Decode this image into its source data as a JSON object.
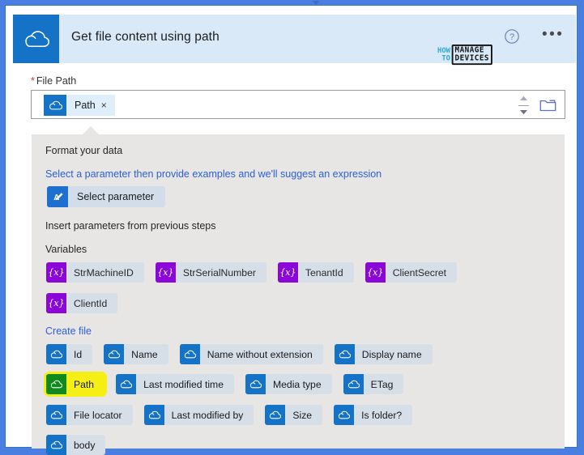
{
  "window": {
    "frame_color": "#4a7ee0",
    "inner_border_color": "#2f7ab5"
  },
  "header": {
    "title": "Get file content using path",
    "connector_icon": "onedrive-cloud-icon",
    "help_icon": "help-question-icon",
    "more_icon": "more-ellipsis-icon",
    "background": "#d9e9f8"
  },
  "watermark": {
    "line1": "HOW",
    "line2": "TO",
    "boxed1": "MANAGE",
    "boxed2": "DEVICES",
    "accent": "#29a9e0"
  },
  "file_path": {
    "label": "File Path",
    "required_marker": "*",
    "chip": {
      "label": "Path",
      "remove": "×",
      "icon": "onedrive-cloud-icon"
    },
    "stepper_icon": "stepper-up-down-icon",
    "folder_icon": "folder-picker-icon",
    "placeholder": ""
  },
  "flyout": {
    "format_title": "Format your data",
    "format_link": "Select a parameter then provide examples and we'll suggest an expression",
    "select_parameter": {
      "label": "Select parameter",
      "icon": "ai-expression-icon"
    },
    "insert_title": "Insert parameters from previous steps",
    "groups": [
      {
        "name": "Variables",
        "is_link": false,
        "kind": "var",
        "rows": [
          [
            "StrMachineID",
            "StrSerialNumber",
            "TenantId",
            "ClientSecret"
          ],
          [
            "ClientId"
          ]
        ]
      },
      {
        "name": "Create file",
        "is_link": true,
        "kind": "file",
        "rows": [
          [
            "Id",
            "Name",
            "Name without extension",
            "Display name"
          ],
          [
            "Path",
            "Last modified time",
            "Media type",
            "ETag"
          ],
          [
            "File locator",
            "Last modified by",
            "Size",
            "Is folder?"
          ],
          [
            "body"
          ]
        ]
      }
    ],
    "highlighted_token": "Path",
    "highlight_color": "#f6ef16",
    "highlight_icon_color": "#0f8a1c",
    "background": "#e8e6e4"
  },
  "colors": {
    "connector_blue": "#1473c6",
    "variable_purple": "#8a07d8",
    "link_blue": "#2b5fd9",
    "token_bg": "#d6dee8"
  }
}
